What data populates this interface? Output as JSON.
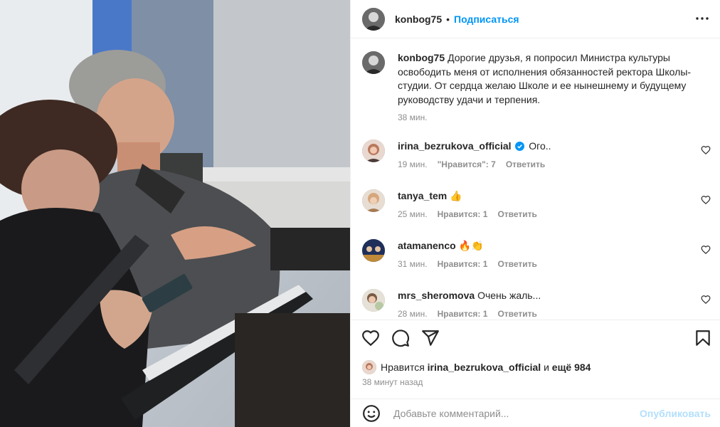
{
  "post": {
    "author": "konbog75",
    "separator": "•",
    "follow_label": "Подписаться",
    "caption": "Дорогие друзья, я попросил Министра культуры освободить меня от исполнения обязанностей ректора Школы-студии. От сердца желаю Школе и ее нынешнему и будущему руководству удачи и терпения.",
    "caption_time": "38 мин."
  },
  "comments": [
    {
      "user": "irina_bezrukova_official",
      "verified": true,
      "text": "Ого..",
      "time": "19 мин.",
      "likes": "\"Нравится\": 7",
      "reply": "Ответить"
    },
    {
      "user": "tanya_tem",
      "text": "👍",
      "time": "25 мин.",
      "likes": "Нравится: 1",
      "reply": "Ответить"
    },
    {
      "user": "atamanenco",
      "text": "🔥👏",
      "time": "31 мин.",
      "likes": "Нравится: 1",
      "reply": "Ответить"
    },
    {
      "user": "mrs_sheromova",
      "text": "Очень жаль...",
      "time": "28 мин.",
      "likes": "Нравится: 1",
      "reply": "Ответить"
    }
  ],
  "likes": {
    "prefix": "Нравится",
    "user": "irina_bezrukova_official",
    "and": "и",
    "more": "ещё 984"
  },
  "posted_ago": "38 минут назад",
  "comment_box": {
    "placeholder": "Добавьте комментарий...",
    "publish_label": "Опубликовать"
  },
  "icons": [
    "more-icon",
    "heart-icon",
    "comment-icon",
    "share-icon",
    "bookmark-icon",
    "emoji-icon",
    "verified-icon"
  ],
  "colors": {
    "accent": "#0095f6",
    "publish_disabled": "#b2dffc",
    "muted": "#8e8e8e",
    "text": "#262626"
  }
}
